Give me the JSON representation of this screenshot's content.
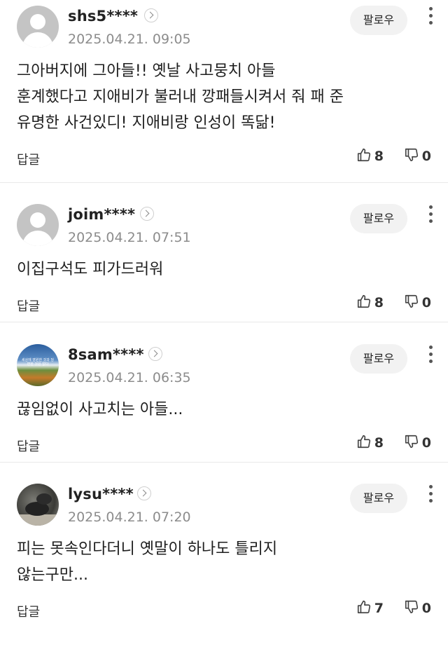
{
  "comments": [
    {
      "username": "shs5****",
      "date": "2025.04.21. 09:05",
      "follow_label": "팔로우",
      "body": "그아버지에 그아들!! 옛날 사고뭉치 아들\n훈계했다고 지애비가 불러내 깡패들시켜서 줘 패 준\n유명한 사건있디! 지애비랑 인성이 똑닮!",
      "reply_label": "답글",
      "likes": "8",
      "dislikes": "0",
      "avatar": "default-avatar-icon"
    },
    {
      "username": "joim****",
      "date": "2025.04.21. 07:51",
      "follow_label": "팔로우",
      "body": "이집구석도 피가드러워",
      "reply_label": "답글",
      "likes": "8",
      "dislikes": "0",
      "avatar": "default-avatar-icon"
    },
    {
      "username": "8sam****",
      "date": "2025.04.21. 06:35",
      "follow_label": "팔로우",
      "body": "끊임없이 사고치는 아들...",
      "reply_label": "답글",
      "likes": "8",
      "dislikes": "0",
      "avatar": "landscape-photo-avatar",
      "avatar_caption": "세상에 영원한 것과 당연한 것은 없다"
    },
    {
      "username": "lysu****",
      "date": "2025.04.21. 07:20",
      "follow_label": "팔로우",
      "body": "피는 못속인다더니 옛말이 하나도 틀리지\n않는구만...",
      "reply_label": "답글",
      "likes": "7",
      "dislikes": "0",
      "avatar": "animal-photo-avatar"
    }
  ],
  "icons": {
    "chevron": "chevron-right-icon",
    "more": "more-vertical-icon",
    "like": "thumbs-up-icon",
    "dislike": "thumbs-down-icon"
  },
  "colors": {
    "text": "#1e1e1e",
    "muted": "#8c8c8c",
    "follow_bg": "#f2f2f2",
    "divider": "#e9e9e9"
  }
}
